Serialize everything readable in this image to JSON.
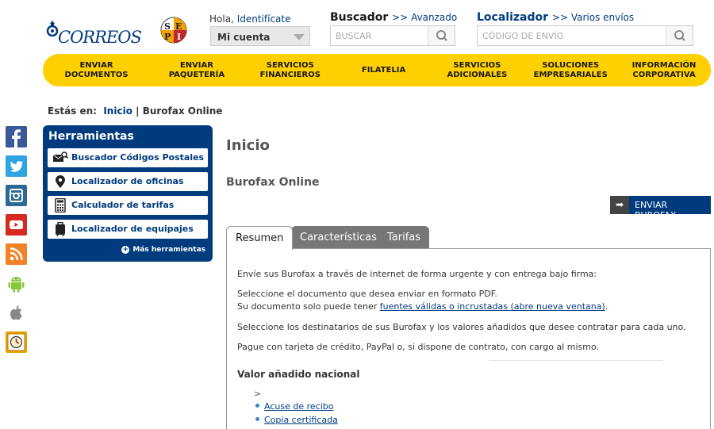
{
  "header": {
    "logo_text": "CORREOS",
    "sepi_text": "SEPI",
    "greeting": "Hola,",
    "login_link": "Identifícate",
    "account_select": "Mi cuenta",
    "search_title": "Buscador",
    "search_sub": ">> Avanzado",
    "search_placeholder": "BUSCAR",
    "tracker_title": "Localizador",
    "tracker_sub": ">> Varios envíos",
    "tracker_placeholder": "CÓDIGO DE ENVÍO"
  },
  "nav": [
    {
      "l1": "ENVIAR",
      "l2": "DOCUMENTOS"
    },
    {
      "l1": "ENVIAR",
      "l2": "PAQUETERÍA"
    },
    {
      "l1": "SERVICIOS",
      "l2": "FINANCIEROS"
    },
    {
      "l1": "FILATELIA",
      "l2": ""
    },
    {
      "l1": "SERVICIOS",
      "l2": "ADICIONALES"
    },
    {
      "l1": "SOLUCIONES",
      "l2": "EMPRESARIALES"
    },
    {
      "l1": "INFORMACIÓN",
      "l2": "CORPORATIVA"
    }
  ],
  "social": [
    "facebook-icon",
    "twitter-icon",
    "instagram-icon",
    "youtube-icon",
    "rss-icon",
    "android-icon",
    "apple-icon",
    "clock-icon"
  ],
  "breadcrumb": {
    "label": "Estás en:",
    "link": "Inicio",
    "sep": "|",
    "current": "Burofax Online"
  },
  "tools": {
    "title": "Herramientas",
    "items": [
      "Buscador Códigos Postales",
      "Localizador de oficinas",
      "Calculador de tarifas",
      "Localizador de equipajes"
    ],
    "more": "Más herramientas"
  },
  "main": {
    "title": "Inicio",
    "subtitle": "Burofax Online",
    "send_button": "ENVIAR BUROFAX",
    "tabs": [
      "Resumen",
      "Características",
      "Tarifas"
    ],
    "p1": "Envíe sus Burofax a través de internet de forma urgente y con entrega bajo firma:",
    "p2a": "Seleccione el documento que desea enviar en formato PDF.",
    "p2b": "Su documento solo puede tener",
    "p2_link": "fuentes válidas o incrustadas (abre nueva ventana)",
    "p2_end": ".",
    "p3": "Seleccione los destinatarios de sus Burofax y los valores añadidos que desee contratar para cada uno.",
    "p4": "Pague con tarjeta de crédito, PayPal o, si dispone de contrato, con cargo al mismo.",
    "value_title": "Valor añadido nacional",
    "arrow": ">",
    "links": [
      "Acuse de recibo",
      "Copia certificada"
    ]
  },
  "colors": {
    "brand_blue": "#003b7e",
    "brand_yellow": "#ffd000"
  }
}
